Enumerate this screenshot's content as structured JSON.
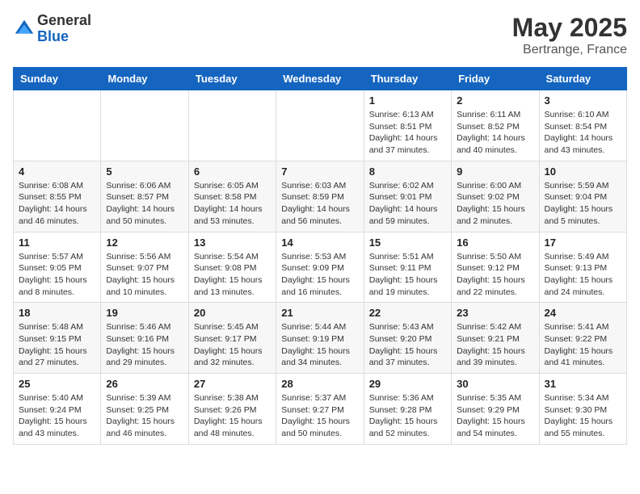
{
  "header": {
    "logo_general": "General",
    "logo_blue": "Blue",
    "title": "May 2025",
    "location": "Bertrange, France"
  },
  "weekdays": [
    "Sunday",
    "Monday",
    "Tuesday",
    "Wednesday",
    "Thursday",
    "Friday",
    "Saturday"
  ],
  "weeks": [
    [
      null,
      null,
      null,
      null,
      {
        "day": "1",
        "sunrise": "6:13 AM",
        "sunset": "8:51 PM",
        "daylight": "14 hours and 37 minutes."
      },
      {
        "day": "2",
        "sunrise": "6:11 AM",
        "sunset": "8:52 PM",
        "daylight": "14 hours and 40 minutes."
      },
      {
        "day": "3",
        "sunrise": "6:10 AM",
        "sunset": "8:54 PM",
        "daylight": "14 hours and 43 minutes."
      }
    ],
    [
      {
        "day": "4",
        "sunrise": "6:08 AM",
        "sunset": "8:55 PM",
        "daylight": "14 hours and 46 minutes."
      },
      {
        "day": "5",
        "sunrise": "6:06 AM",
        "sunset": "8:57 PM",
        "daylight": "14 hours and 50 minutes."
      },
      {
        "day": "6",
        "sunrise": "6:05 AM",
        "sunset": "8:58 PM",
        "daylight": "14 hours and 53 minutes."
      },
      {
        "day": "7",
        "sunrise": "6:03 AM",
        "sunset": "8:59 PM",
        "daylight": "14 hours and 56 minutes."
      },
      {
        "day": "8",
        "sunrise": "6:02 AM",
        "sunset": "9:01 PM",
        "daylight": "14 hours and 59 minutes."
      },
      {
        "day": "9",
        "sunrise": "6:00 AM",
        "sunset": "9:02 PM",
        "daylight": "15 hours and 2 minutes."
      },
      {
        "day": "10",
        "sunrise": "5:59 AM",
        "sunset": "9:04 PM",
        "daylight": "15 hours and 5 minutes."
      }
    ],
    [
      {
        "day": "11",
        "sunrise": "5:57 AM",
        "sunset": "9:05 PM",
        "daylight": "15 hours and 8 minutes."
      },
      {
        "day": "12",
        "sunrise": "5:56 AM",
        "sunset": "9:07 PM",
        "daylight": "15 hours and 10 minutes."
      },
      {
        "day": "13",
        "sunrise": "5:54 AM",
        "sunset": "9:08 PM",
        "daylight": "15 hours and 13 minutes."
      },
      {
        "day": "14",
        "sunrise": "5:53 AM",
        "sunset": "9:09 PM",
        "daylight": "15 hours and 16 minutes."
      },
      {
        "day": "15",
        "sunrise": "5:51 AM",
        "sunset": "9:11 PM",
        "daylight": "15 hours and 19 minutes."
      },
      {
        "day": "16",
        "sunrise": "5:50 AM",
        "sunset": "9:12 PM",
        "daylight": "15 hours and 22 minutes."
      },
      {
        "day": "17",
        "sunrise": "5:49 AM",
        "sunset": "9:13 PM",
        "daylight": "15 hours and 24 minutes."
      }
    ],
    [
      {
        "day": "18",
        "sunrise": "5:48 AM",
        "sunset": "9:15 PM",
        "daylight": "15 hours and 27 minutes."
      },
      {
        "day": "19",
        "sunrise": "5:46 AM",
        "sunset": "9:16 PM",
        "daylight": "15 hours and 29 minutes."
      },
      {
        "day": "20",
        "sunrise": "5:45 AM",
        "sunset": "9:17 PM",
        "daylight": "15 hours and 32 minutes."
      },
      {
        "day": "21",
        "sunrise": "5:44 AM",
        "sunset": "9:19 PM",
        "daylight": "15 hours and 34 minutes."
      },
      {
        "day": "22",
        "sunrise": "5:43 AM",
        "sunset": "9:20 PM",
        "daylight": "15 hours and 37 minutes."
      },
      {
        "day": "23",
        "sunrise": "5:42 AM",
        "sunset": "9:21 PM",
        "daylight": "15 hours and 39 minutes."
      },
      {
        "day": "24",
        "sunrise": "5:41 AM",
        "sunset": "9:22 PM",
        "daylight": "15 hours and 41 minutes."
      }
    ],
    [
      {
        "day": "25",
        "sunrise": "5:40 AM",
        "sunset": "9:24 PM",
        "daylight": "15 hours and 43 minutes."
      },
      {
        "day": "26",
        "sunrise": "5:39 AM",
        "sunset": "9:25 PM",
        "daylight": "15 hours and 46 minutes."
      },
      {
        "day": "27",
        "sunrise": "5:38 AM",
        "sunset": "9:26 PM",
        "daylight": "15 hours and 48 minutes."
      },
      {
        "day": "28",
        "sunrise": "5:37 AM",
        "sunset": "9:27 PM",
        "daylight": "15 hours and 50 minutes."
      },
      {
        "day": "29",
        "sunrise": "5:36 AM",
        "sunset": "9:28 PM",
        "daylight": "15 hours and 52 minutes."
      },
      {
        "day": "30",
        "sunrise": "5:35 AM",
        "sunset": "9:29 PM",
        "daylight": "15 hours and 54 minutes."
      },
      {
        "day": "31",
        "sunrise": "5:34 AM",
        "sunset": "9:30 PM",
        "daylight": "15 hours and 55 minutes."
      }
    ]
  ],
  "labels": {
    "sunrise": "Sunrise:",
    "sunset": "Sunset:",
    "daylight": "Daylight:"
  }
}
